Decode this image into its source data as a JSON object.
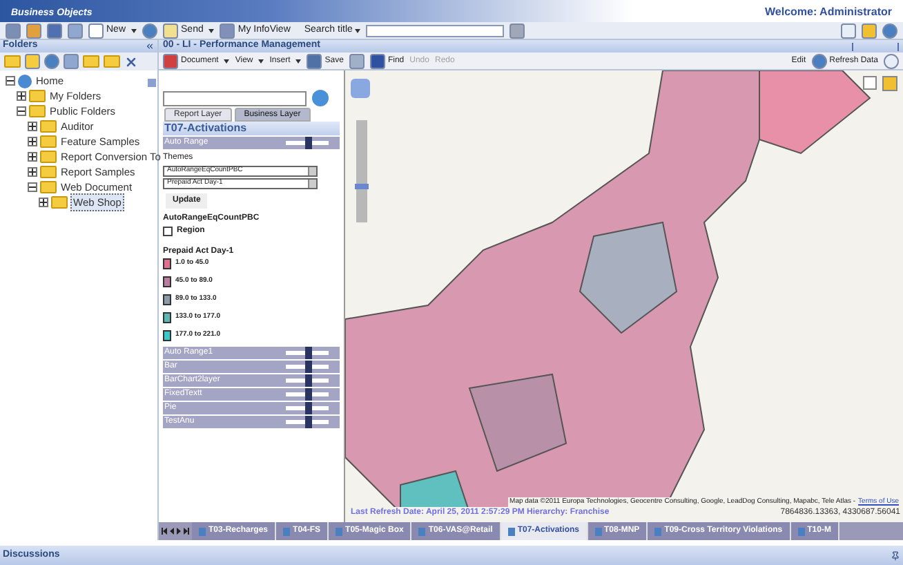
{
  "banner": {
    "logo": "Business Objects",
    "welcome": "Welcome: Administrator"
  },
  "toolbar": {
    "new": "New",
    "send": "Send",
    "infoview": "My InfoView",
    "search_label": "Search title"
  },
  "folders": {
    "title": "Folders",
    "tree": [
      {
        "label": "Home",
        "expanded": true,
        "kind": "home",
        "children": [
          {
            "label": "My Folders",
            "expanded": false
          },
          {
            "label": "Public Folders",
            "expanded": true,
            "children": [
              {
                "label": "Auditor",
                "expanded": false
              },
              {
                "label": "Feature Samples",
                "expanded": false
              },
              {
                "label": "Report Conversion To",
                "expanded": false
              },
              {
                "label": "Report Samples",
                "expanded": false
              },
              {
                "label": "Web Document",
                "expanded": true,
                "children": [
                  {
                    "label": "Web Shop",
                    "expanded": false,
                    "selected": true
                  }
                ]
              }
            ]
          }
        ]
      }
    ]
  },
  "document": {
    "title": "00 - LI - Performance Management",
    "menus": [
      "Document",
      "View",
      "Insert"
    ],
    "save": "Save",
    "find": "Find",
    "undo": {
      "label": "Undo",
      "disabled": true
    },
    "redo": {
      "label": "Redo",
      "disabled": true
    },
    "edit": "Edit",
    "refresh": "Refresh Data"
  },
  "layers": {
    "tabs": [
      {
        "label": "Report Layer",
        "selected": false
      },
      {
        "label": "Business Layer",
        "selected": true
      }
    ],
    "title": "T07-Activations",
    "top_layer": {
      "name": "Auto Range",
      "level": 0.5
    },
    "themes_label": "Themes",
    "theme_select": "AutoRangeEqCountPBC",
    "field_select": "Prepaid Act Day-1",
    "update": "Update",
    "region_title": "AutoRangeEqCountPBC",
    "region": {
      "label": "Region",
      "checked": false
    },
    "legend_title": "Prepaid Act Day-1",
    "legend": [
      {
        "label": "1.0 to 45.0",
        "color": "#e0708f"
      },
      {
        "label": "45.0 to 89.0",
        "color": "#b87f9a"
      },
      {
        "label": "89.0 to 133.0",
        "color": "#8e9aa6"
      },
      {
        "label": "133.0 to 177.0",
        "color": "#5cb8b2"
      },
      {
        "label": "177.0 to 221.0",
        "color": "#3cc8c8"
      }
    ],
    "rows": [
      {
        "name": "Auto Range1",
        "level": 0.5
      },
      {
        "name": "Bar",
        "level": 0.5
      },
      {
        "name": "BarChart2layer",
        "level": 0.5
      },
      {
        "name": "FixedTextt",
        "level": 0.5
      },
      {
        "name": "Pie",
        "level": 0.5
      },
      {
        "name": "TestAnu",
        "level": 0.5
      }
    ]
  },
  "map": {
    "zoom": {
      "level": 0.35
    },
    "attribution": "Map data ©2011 Europa Technologies, Geocentre Consulting, Google, LeadDog Consulting, Mapabc, Tele Atlas -",
    "terms": "Terms of Use",
    "refresh": "Last Refresh Date: April 25, 2011 2:57:29 PM Hierarchy: Franchise",
    "coords": "7864836.13363, 4330687.56041"
  },
  "report_tabs": [
    {
      "label": "T03-Recharges",
      "selected": false
    },
    {
      "label": "T04-FS",
      "selected": false
    },
    {
      "label": "T05-Magic Box",
      "selected": false
    },
    {
      "label": "T06-VAS@Retail",
      "selected": false
    },
    {
      "label": "T07-Activations",
      "selected": true
    },
    {
      "label": "T08-MNP",
      "selected": false
    },
    {
      "label": "T09-Cross Territory Violations",
      "selected": false
    },
    {
      "label": "T10-M",
      "selected": false
    }
  ],
  "discussions": "Discussions"
}
